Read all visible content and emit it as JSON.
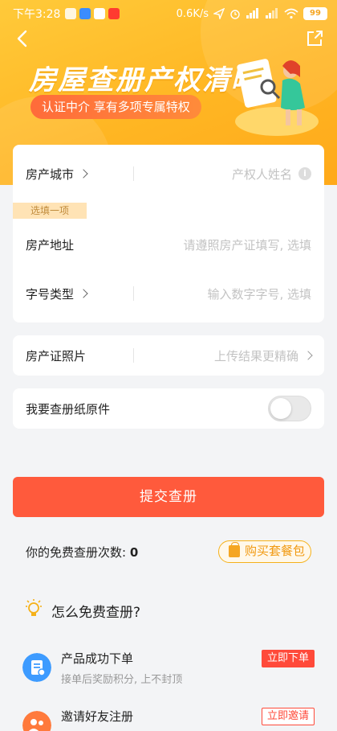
{
  "status_bar": {
    "time": "下午3:28",
    "network_speed": "0.6K/s",
    "battery": "99"
  },
  "banner": {
    "title": "房屋查册产权清晰",
    "subtitle": "认证中介 享有多项专属特权"
  },
  "form": {
    "city_label": "房产城市",
    "owner_placeholder": "产权人姓名",
    "optional_tag": "选填一项",
    "address_label": "房产地址",
    "address_placeholder": "请遵照房产证填写, 选填",
    "number_type_label": "字号类型",
    "number_placeholder": "输入数字字号, 选填",
    "photo_label": "房产证照片",
    "photo_hint": "上传结果更精确",
    "paper_label": "我要查册纸原件",
    "paper_toggle_on": false
  },
  "submit_label": "提交查册",
  "free_count": {
    "label": "你的免费查册次数:",
    "value": "0"
  },
  "buy_package_label": "购买套餐包",
  "how_free_title": "怎么免费查册?",
  "tasks": [
    {
      "title": "产品成功下单",
      "desc": "接单后奖励积分, 上不封顶",
      "action": "立即下单"
    },
    {
      "title": "邀请好友注册",
      "desc": "",
      "action": "立即邀请"
    }
  ],
  "colors": {
    "brand_orange": "#ffb623",
    "submit_red": "#ff5a3c",
    "action_red": "#ff4a3a"
  }
}
